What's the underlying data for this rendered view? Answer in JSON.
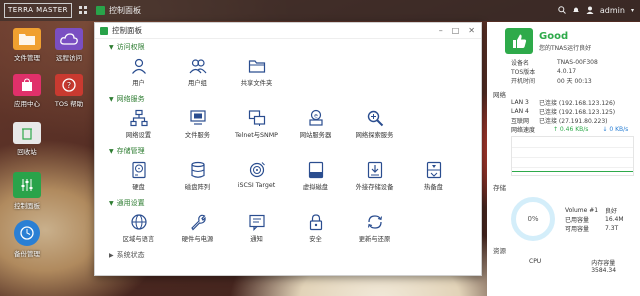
{
  "topbar": {
    "logo": "TERRA MASTER",
    "user": "admin"
  },
  "taskbar": {
    "active_app": "控制面板"
  },
  "desktop": {
    "icons": [
      {
        "label": "文件管理",
        "color": "#f0a030"
      },
      {
        "label": "远程访问",
        "color": "#7a4fc2"
      },
      {
        "label": "应用中心",
        "color": "#e0306a"
      },
      {
        "label": "TOS 帮助",
        "color": "#c93a30"
      },
      {
        "label": "回收站",
        "color": "#e8e8e8"
      },
      {
        "label": "控制面板",
        "color": "#29a34a"
      },
      {
        "label": "备份管理",
        "color": "#2a7fd4"
      }
    ]
  },
  "window": {
    "title": "控制面板",
    "sections": [
      {
        "label": "访问权限",
        "items": [
          {
            "label": "用户",
            "icon": "user-icon"
          },
          {
            "label": "用户组",
            "icon": "user-group-icon"
          },
          {
            "label": "共享文件夹",
            "icon": "shared-folder-icon"
          }
        ]
      },
      {
        "label": "网络服务",
        "items": [
          {
            "label": "网络设置",
            "icon": "network-settings-icon"
          },
          {
            "label": "文件服务",
            "icon": "file-service-icon"
          },
          {
            "label": "Telnet与SNMP",
            "icon": "telnet-snmp-icon"
          },
          {
            "label": "网站服务器",
            "icon": "web-server-icon"
          },
          {
            "label": "网络探索服务",
            "icon": "network-discovery-icon"
          }
        ]
      },
      {
        "label": "存储管理",
        "items": [
          {
            "label": "硬盘",
            "icon": "hard-disk-icon"
          },
          {
            "label": "磁盘阵列",
            "icon": "disk-array-icon"
          },
          {
            "label": "iSCSI Target",
            "icon": "iscsi-target-icon"
          },
          {
            "label": "虚拟磁盘",
            "icon": "virtual-disk-icon"
          },
          {
            "label": "外接存储设备",
            "icon": "external-storage-icon"
          },
          {
            "label": "热备盘",
            "icon": "hot-spare-icon"
          }
        ]
      },
      {
        "label": "通用设置",
        "items": [
          {
            "label": "区域与语言",
            "icon": "region-language-icon"
          },
          {
            "label": "硬件与电源",
            "icon": "hardware-power-icon"
          },
          {
            "label": "通知",
            "icon": "notification-icon"
          },
          {
            "label": "安全",
            "icon": "security-icon"
          },
          {
            "label": "更新与还原",
            "icon": "update-restore-icon"
          }
        ]
      },
      {
        "label": "系统状态",
        "items": []
      }
    ]
  },
  "status": {
    "health": "Good",
    "health_desc": "您的TNAS运行良好",
    "device": [
      {
        "k": "设备名",
        "v": "TNAS-00F308"
      },
      {
        "k": "TOS版本",
        "v": "4.0.17"
      },
      {
        "k": "开机时间",
        "v": "00 天 00:13"
      }
    ],
    "network_title": "网络",
    "network": [
      {
        "k": "LAN 3",
        "v": "已连接 (192.168.123.126)"
      },
      {
        "k": "LAN 4",
        "v": "已连接 (192.168.123.125)"
      },
      {
        "k": "互联网",
        "v": "已连接 (27.191.80.223)"
      },
      {
        "k": "网络速度",
        "v": ""
      }
    ],
    "speed_up": "↑ 0.46 KB/s",
    "speed_down": "↓ 0 KB/s",
    "storage_title": "存储",
    "storage_percent": "0%",
    "volume": [
      {
        "k": "Volume #1",
        "v": "良好"
      },
      {
        "k": "已用容量",
        "v": "16.4M"
      },
      {
        "k": "可用容量",
        "v": "7.3T"
      }
    ],
    "resource_title": "资源",
    "cpu_label": "CPU",
    "memory_label": "内存容量 3584.34"
  },
  "colors": {
    "accent": "#29a34a",
    "good": "#2eaa4a"
  }
}
